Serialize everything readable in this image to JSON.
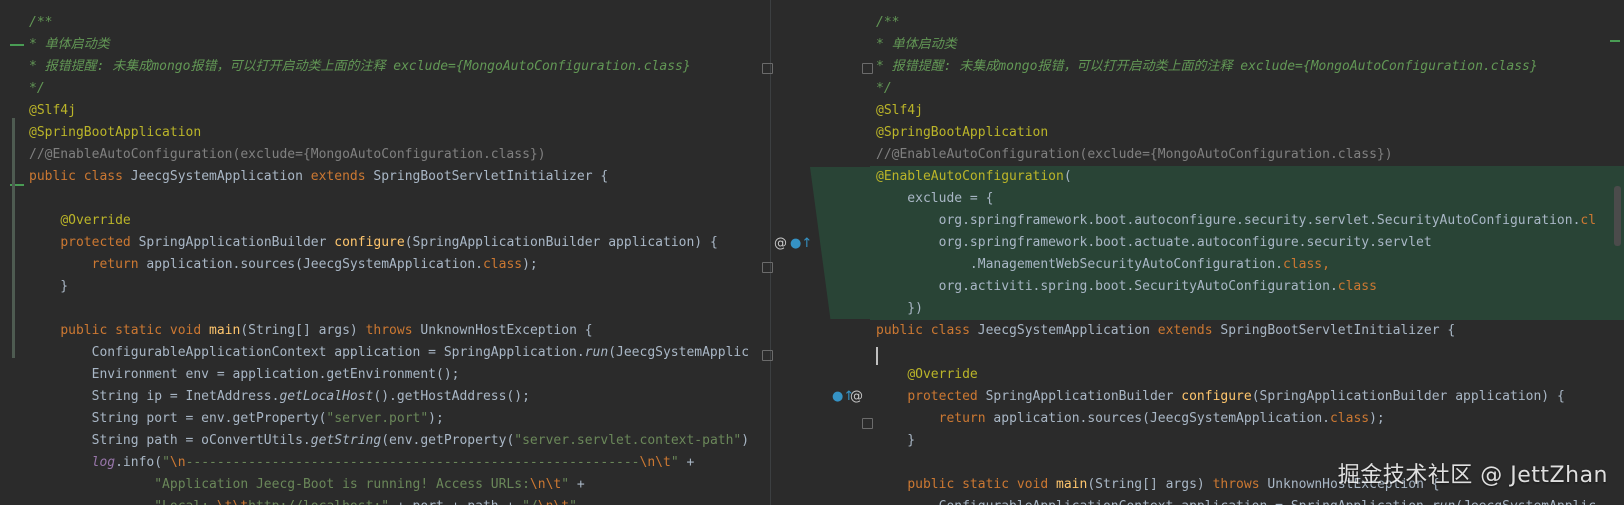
{
  "left_pane": {
    "lines": [
      {
        "cls": "t-doc",
        "text": "/**"
      },
      {
        "cls": "t-doc",
        "text": "* 单体启动类"
      },
      {
        "cls": "t-doc",
        "text": "* 报错提醒: 未集成mongo报错，可以打开启动类上面的注释 exclude={MongoAutoConfiguration.class}"
      },
      {
        "cls": "t-doc",
        "text": "*/"
      },
      {
        "cls": "t-anno",
        "text": "@Slf4j"
      },
      {
        "cls": "t-anno",
        "text": "@SpringBootApplication"
      },
      {
        "cls": "t-comment",
        "text": "//@EnableAutoConfiguration(exclude={MongoAutoConfiguration.class})"
      },
      {
        "segments": [
          {
            "c": "t-kw",
            "t": "public class "
          },
          {
            "c": "t-plain",
            "t": "JeecgSystemApplication "
          },
          {
            "c": "t-kw",
            "t": "extends "
          },
          {
            "c": "t-plain",
            "t": "SpringBootServletInitializer {"
          }
        ]
      },
      {
        "text": ""
      },
      {
        "segments": [
          {
            "c": "t-plain",
            "t": "    "
          },
          {
            "c": "t-anno",
            "t": "@Override"
          }
        ]
      },
      {
        "segments": [
          {
            "c": "t-plain",
            "t": "    "
          },
          {
            "c": "t-kw",
            "t": "protected "
          },
          {
            "c": "t-plain",
            "t": "SpringApplicationBuilder "
          },
          {
            "c": "t-fn",
            "t": "configure"
          },
          {
            "c": "t-plain",
            "t": "(SpringApplicationBuilder application) {"
          }
        ]
      },
      {
        "segments": [
          {
            "c": "t-plain",
            "t": "        "
          },
          {
            "c": "t-kw",
            "t": "return "
          },
          {
            "c": "t-plain",
            "t": "application.sources(JeecgSystemApplication."
          },
          {
            "c": "t-kw",
            "t": "class"
          },
          {
            "c": "t-plain",
            "t": ");"
          }
        ]
      },
      {
        "segments": [
          {
            "c": "t-plain",
            "t": "    }"
          }
        ]
      },
      {
        "text": ""
      },
      {
        "segments": [
          {
            "c": "t-plain",
            "t": "    "
          },
          {
            "c": "t-kw",
            "t": "public static void "
          },
          {
            "c": "t-fn",
            "t": "main"
          },
          {
            "c": "t-plain",
            "t": "(String[] args) "
          },
          {
            "c": "t-kw",
            "t": "throws "
          },
          {
            "c": "t-plain",
            "t": "UnknownHostException {"
          }
        ]
      },
      {
        "segments": [
          {
            "c": "t-plain",
            "t": "        ConfigurableApplicationContext application = SpringApplication."
          },
          {
            "c": "t-plain t-italic",
            "t": "run"
          },
          {
            "c": "t-plain",
            "t": "(JeecgSystemApplic"
          }
        ]
      },
      {
        "segments": [
          {
            "c": "t-plain",
            "t": "        Environment env = application.getEnvironment();"
          }
        ]
      },
      {
        "segments": [
          {
            "c": "t-plain",
            "t": "        String ip = InetAddress."
          },
          {
            "c": "t-plain t-italic",
            "t": "getLocalHost"
          },
          {
            "c": "t-plain",
            "t": "().getHostAddress();"
          }
        ]
      },
      {
        "segments": [
          {
            "c": "t-plain",
            "t": "        String port = env.getProperty("
          },
          {
            "c": "t-str",
            "t": "\"server.port\""
          },
          {
            "c": "t-plain",
            "t": ");"
          }
        ]
      },
      {
        "segments": [
          {
            "c": "t-plain",
            "t": "        String path = oConvertUtils."
          },
          {
            "c": "t-plain t-italic",
            "t": "getString"
          },
          {
            "c": "t-plain",
            "t": "(env.getProperty("
          },
          {
            "c": "t-str",
            "t": "\"server.servlet.context-path\""
          },
          {
            "c": "t-plain",
            "t": ")"
          }
        ]
      },
      {
        "segments": [
          {
            "c": "t-plain",
            "t": "        "
          },
          {
            "c": "t-field",
            "t": "log"
          },
          {
            "c": "t-plain",
            "t": ".info("
          },
          {
            "c": "t-str",
            "t": "\""
          },
          {
            "c": "t-esc",
            "t": "\\n"
          },
          {
            "c": "t-str",
            "t": "----------------------------------------------------------"
          },
          {
            "c": "t-esc",
            "t": "\\n\\t"
          },
          {
            "c": "t-str",
            "t": "\""
          },
          {
            "c": "t-plain",
            "t": " +"
          }
        ]
      },
      {
        "segments": [
          {
            "c": "t-plain",
            "t": "                "
          },
          {
            "c": "t-str",
            "t": "\"Application Jeecg-Boot is running! Access URLs:"
          },
          {
            "c": "t-esc",
            "t": "\\n\\t"
          },
          {
            "c": "t-str",
            "t": "\""
          },
          {
            "c": "t-plain",
            "t": " +"
          }
        ]
      },
      {
        "segments": [
          {
            "c": "t-plain",
            "t": "                "
          },
          {
            "c": "t-str",
            "t": "\"Local: "
          },
          {
            "c": "t-esc",
            "t": "\\t\\t"
          },
          {
            "c": "t-str",
            "t": "http://localhost:\""
          },
          {
            "c": "t-plain",
            "t": " + port + path + "
          },
          {
            "c": "t-str",
            "t": "\"/"
          },
          {
            "c": "t-esc",
            "t": "\\n\\t"
          },
          {
            "c": "t-str",
            "t": "\""
          }
        ]
      }
    ]
  },
  "right_pane": {
    "lines": [
      {
        "cls": "t-doc",
        "text": "/**"
      },
      {
        "cls": "t-doc",
        "text": "* 单体启动类"
      },
      {
        "cls": "t-doc",
        "text": "* 报错提醒: 未集成mongo报错，可以打开启动类上面的注释 exclude={MongoAutoConfiguration.class}"
      },
      {
        "cls": "t-doc",
        "text": "*/"
      },
      {
        "cls": "t-anno",
        "text": "@Slf4j"
      },
      {
        "cls": "t-anno",
        "text": "@SpringBootApplication"
      },
      {
        "cls": "t-comment",
        "text": "//@EnableAutoConfiguration(exclude={MongoAutoConfiguration.class})"
      },
      {
        "added": true,
        "segments": [
          {
            "c": "t-anno",
            "t": "@EnableAutoConfiguration"
          },
          {
            "c": "t-plain",
            "t": "("
          }
        ]
      },
      {
        "added": true,
        "segments": [
          {
            "c": "t-plain",
            "t": "    exclude = {"
          }
        ]
      },
      {
        "added": true,
        "segments": [
          {
            "c": "t-plain",
            "t": "        org.springframework.boot.autoconfigure.security.servlet.SecurityAutoConfiguration."
          },
          {
            "c": "t-kw",
            "t": "cl"
          }
        ]
      },
      {
        "added": true,
        "segments": [
          {
            "c": "t-plain",
            "t": "        org.springframework.boot.actuate.autoconfigure.security.servlet"
          }
        ]
      },
      {
        "added": true,
        "segments": [
          {
            "c": "t-plain",
            "t": "            .ManagementWebSecurityAutoConfiguration."
          },
          {
            "c": "t-kw",
            "t": "class,"
          }
        ]
      },
      {
        "added": true,
        "segments": [
          {
            "c": "t-plain",
            "t": "        org.activiti.spring.boot.SecurityAutoConfiguration."
          },
          {
            "c": "t-kw",
            "t": "class"
          }
        ]
      },
      {
        "added": true,
        "segments": [
          {
            "c": "t-plain",
            "t": "    })"
          }
        ]
      },
      {
        "segments": [
          {
            "c": "t-kw",
            "t": "public class "
          },
          {
            "c": "t-plain",
            "t": "JeecgSystemApplication "
          },
          {
            "c": "t-kw",
            "t": "extends "
          },
          {
            "c": "t-plain",
            "t": "SpringBootServletInitializer {"
          }
        ]
      },
      {
        "text": ""
      },
      {
        "segments": [
          {
            "c": "t-plain",
            "t": "    "
          },
          {
            "c": "t-anno",
            "t": "@Override"
          }
        ]
      },
      {
        "segments": [
          {
            "c": "t-plain",
            "t": "    "
          },
          {
            "c": "t-kw",
            "t": "protected "
          },
          {
            "c": "t-plain",
            "t": "SpringApplicationBuilder "
          },
          {
            "c": "t-fn",
            "t": "configure"
          },
          {
            "c": "t-plain",
            "t": "(SpringApplicationBuilder application) {"
          }
        ]
      },
      {
        "segments": [
          {
            "c": "t-plain",
            "t": "        "
          },
          {
            "c": "t-kw",
            "t": "return "
          },
          {
            "c": "t-plain",
            "t": "application.sources(JeecgSystemApplication."
          },
          {
            "c": "t-kw",
            "t": "class"
          },
          {
            "c": "t-plain",
            "t": ");"
          }
        ]
      },
      {
        "segments": [
          {
            "c": "t-plain",
            "t": "    }"
          }
        ]
      },
      {
        "text": ""
      },
      {
        "segments": [
          {
            "c": "t-plain",
            "t": "    "
          },
          {
            "c": "t-kw",
            "t": "public static void "
          },
          {
            "c": "t-fn",
            "t": "main"
          },
          {
            "c": "t-plain",
            "t": "(String[] args) "
          },
          {
            "c": "t-kw",
            "t": "throws "
          },
          {
            "c": "t-plain",
            "t": "UnknownHostException {"
          }
        ]
      },
      {
        "segments": [
          {
            "c": "t-plain",
            "t": "        ConfigurableApplicationContext application = SpringApplication."
          },
          {
            "c": "t-plain t-italic",
            "t": "run"
          },
          {
            "c": "t-plain",
            "t": "(JeecgSystemApplic"
          }
        ]
      }
    ]
  },
  "gutter_icons": {
    "override_left": "@",
    "override_right": "@",
    "implements_marker": "●↑"
  },
  "watermark": "掘金技术社区 @ JettZhan"
}
